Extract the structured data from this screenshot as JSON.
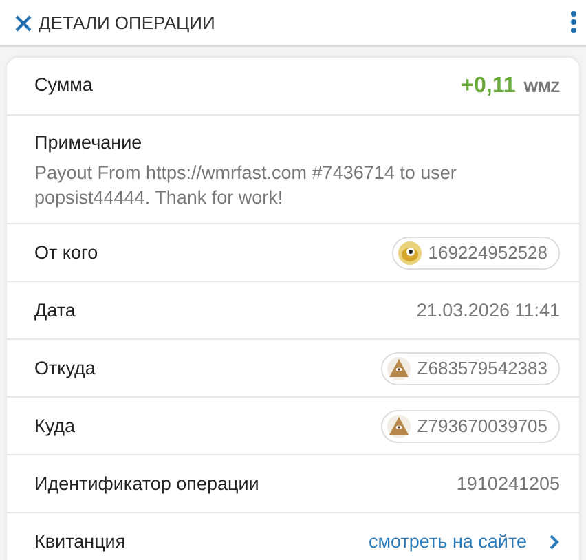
{
  "header": {
    "title": "ДЕТАЛИ ОПЕРАЦИИ"
  },
  "rows": [
    {
      "kind": "amount",
      "label": "Сумма",
      "value": "+0,11",
      "unit": "WMZ"
    },
    {
      "kind": "note",
      "label": "Примечание",
      "value": "Payout From https://wmrfast.com #7436714 to user popsist44444. Thank for work!"
    },
    {
      "kind": "wmid",
      "label": "От кого",
      "value": "169224952528"
    },
    {
      "kind": "plain",
      "label": "Дата",
      "value": "21.03.2026 11:41"
    },
    {
      "kind": "purse",
      "label": "Откуда",
      "value": "Z683579542383"
    },
    {
      "kind": "purse",
      "label": "Куда",
      "value": "Z793670039705"
    },
    {
      "kind": "plain",
      "label": "Идентификатор операции",
      "value": "1910241205"
    },
    {
      "kind": "link",
      "label": "Квитанция",
      "value": "смотреть на сайте"
    }
  ]
}
